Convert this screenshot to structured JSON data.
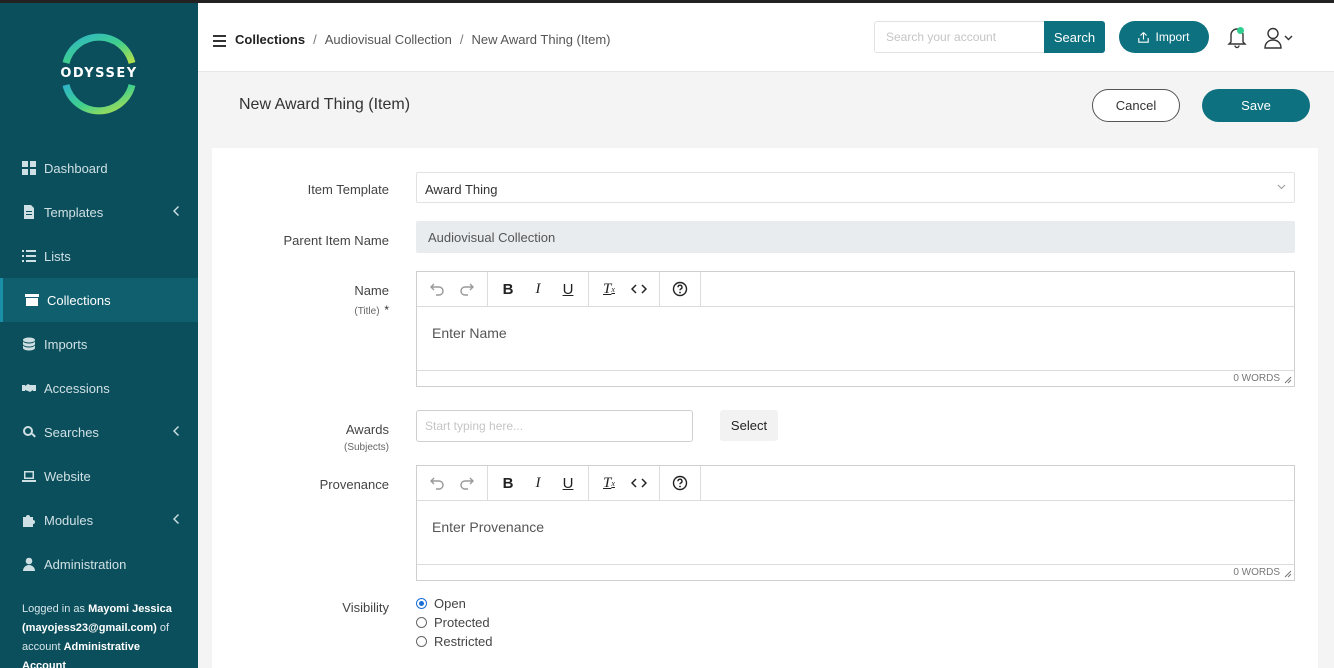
{
  "brand": {
    "logo_text": "ODYSSEY",
    "colors": {
      "sidebar": "#0b4f5c",
      "accent": "#0e7180",
      "active_nav": "#0f5f6e"
    }
  },
  "sidebar": {
    "items": [
      {
        "label": "Dashboard",
        "icon": "dashboard-icon"
      },
      {
        "label": "Templates",
        "icon": "file-icon",
        "has_submenu": true
      },
      {
        "label": "Lists",
        "icon": "list-icon"
      },
      {
        "label": "Collections",
        "icon": "archive-icon",
        "active": true
      },
      {
        "label": "Imports",
        "icon": "database-icon"
      },
      {
        "label": "Accessions",
        "icon": "handshake-icon"
      },
      {
        "label": "Searches",
        "icon": "search-icon",
        "has_submenu": true
      },
      {
        "label": "Website",
        "icon": "laptop-icon"
      },
      {
        "label": "Modules",
        "icon": "puzzle-icon",
        "has_submenu": true
      },
      {
        "label": "Administration",
        "icon": "user-icon"
      }
    ],
    "logged_in": {
      "prefix": "Logged in as",
      "user": "Mayomi Jessica",
      "email": "(mayojess23@gmail.com)",
      "mid": "of account",
      "account": "Administrative Account"
    }
  },
  "header": {
    "breadcrumbs": [
      "Collections",
      "Audiovisual Collection",
      "New Award Thing (Item)"
    ],
    "search_placeholder": "Search your account",
    "search_label": "Search",
    "import_label": "Import"
  },
  "page": {
    "title": "New Award Thing (Item)",
    "cancel_label": "Cancel",
    "save_label": "Save"
  },
  "form": {
    "item_template": {
      "label": "Item Template",
      "value": "Award Thing"
    },
    "parent": {
      "label": "Parent Item Name",
      "value": "Audiovisual Collection"
    },
    "name": {
      "label": "Name",
      "sublabel": "(Title)",
      "required": "*",
      "placeholder": "Enter Name",
      "word_count": "0 WORDS"
    },
    "awards": {
      "label": "Awards",
      "sublabel": "(Subjects)",
      "placeholder": "Start typing here...",
      "select_label": "Select"
    },
    "provenance": {
      "label": "Provenance",
      "placeholder": "Enter Provenance",
      "word_count": "0 WORDS"
    },
    "visibility": {
      "label": "Visibility",
      "options": [
        "Open",
        "Protected",
        "Restricted"
      ],
      "selected": "Open"
    }
  },
  "toolbar": {
    "buttons": [
      "undo-icon",
      "redo-icon",
      "bold-icon",
      "italic-icon",
      "underline-icon",
      "clear-format-icon",
      "code-icon",
      "help-icon"
    ]
  }
}
